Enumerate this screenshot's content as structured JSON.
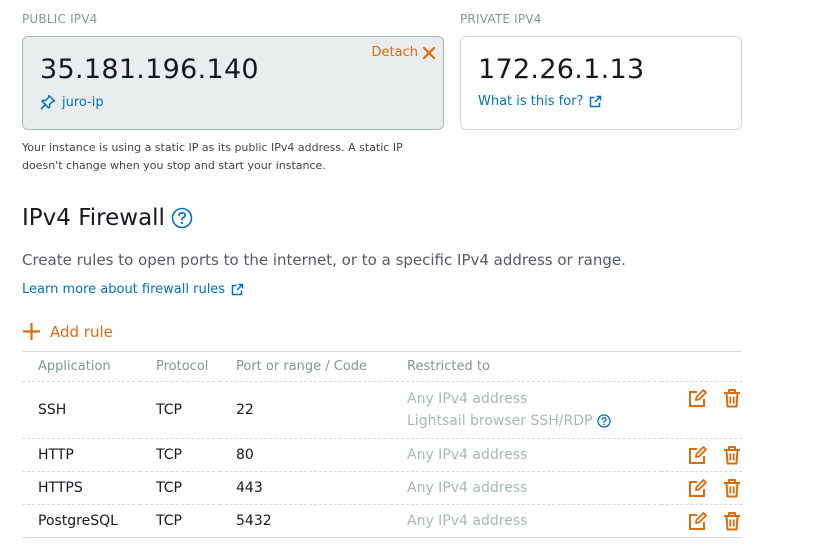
{
  "public_ipv4": {
    "heading": "PUBLIC IPV4",
    "address": "35.181.196.140",
    "detach_label": "Detach",
    "static_ip_name": "juro-ip",
    "note": "Your instance is using a static IP as its public IPv4 address. A static IP doesn't change when you stop and start your instance."
  },
  "private_ipv4": {
    "heading": "PRIVATE IPV4",
    "address": "172.26.1.13",
    "help_link": "What is this for?"
  },
  "firewall": {
    "title": "IPv4 Firewall",
    "description": "Create rules to open ports to the internet, or to a specific IPv4 address or range.",
    "learn_more": "Learn more about firewall rules",
    "add_rule_label": "Add rule",
    "columns": [
      "Application",
      "Protocol",
      "Port or range / Code",
      "Restricted to"
    ],
    "rules": [
      {
        "application": "SSH",
        "protocol": "TCP",
        "port": "22",
        "restricted": "Any IPv4 address",
        "extra": "Lightsail browser SSH/RDP"
      },
      {
        "application": "HTTP",
        "protocol": "TCP",
        "port": "80",
        "restricted": "Any IPv4 address"
      },
      {
        "application": "HTTPS",
        "protocol": "TCP",
        "port": "443",
        "restricted": "Any IPv4 address"
      },
      {
        "application": "PostgreSQL",
        "protocol": "TCP",
        "port": "5432",
        "restricted": "Any IPv4 address"
      }
    ]
  },
  "colors": {
    "accent": "#dd6b10",
    "link": "#0073bb",
    "muted": "#879596",
    "card_bg": "#eaeded"
  }
}
